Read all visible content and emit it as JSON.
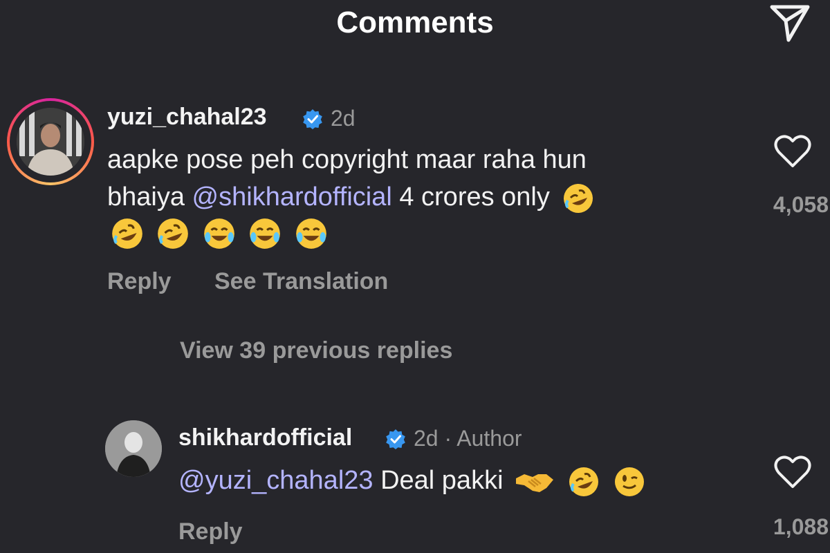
{
  "header": {
    "title": "Comments"
  },
  "comments": [
    {
      "username": "yuzi_chahal23",
      "time": "2d",
      "line1": "aapke pose peh copyright maar raha hun",
      "line2_prefix": "bhaiya ",
      "mention": "@shikhardofficial",
      "line2_suffix": " 4 crores only",
      "like_count": "4,058",
      "actions": {
        "reply": "Reply",
        "translate": "See Translation"
      },
      "emojis": [
        "rofl",
        "rofl",
        "rofl",
        "joy",
        "joy",
        "joy"
      ]
    }
  ],
  "view_replies": "View 39 previous replies",
  "reply": {
    "username": "shikhardofficial",
    "time": "2d",
    "separator": "·",
    "author_label": "Author",
    "mention": "@yuzi_chahal23",
    "text": " Deal pakki",
    "like_count": "1,088",
    "actions": {
      "reply": "Reply"
    },
    "emojis": [
      "handshake",
      "rofl",
      "wink"
    ]
  },
  "colors": {
    "background": "#26262b",
    "mention": "#b4b4ff",
    "verified": "#3897f0",
    "muted": "#9a9a9a"
  },
  "icons": [
    "send-icon",
    "verified-badge-icon",
    "heart-icon",
    "avatar"
  ]
}
